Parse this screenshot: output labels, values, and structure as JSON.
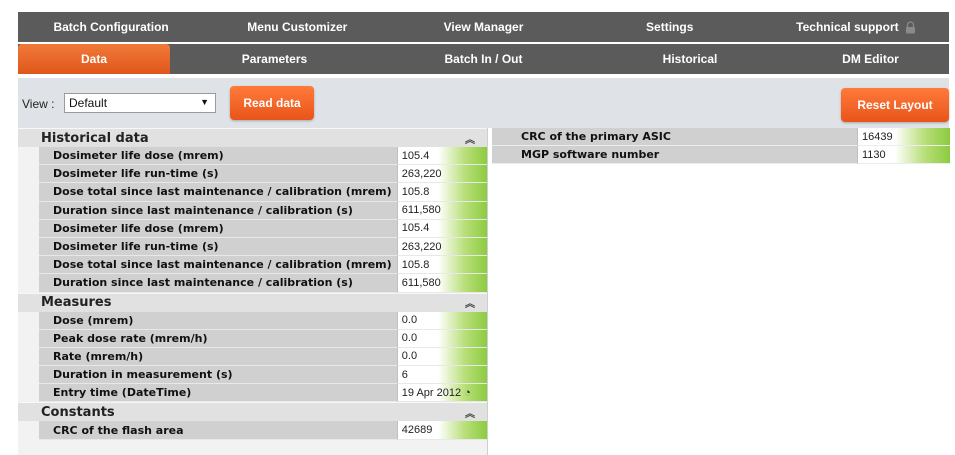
{
  "nav_top": [
    {
      "label": "Batch Configuration"
    },
    {
      "label": "Menu Customizer"
    },
    {
      "label": "View Manager"
    },
    {
      "label": "Settings"
    },
    {
      "label": "Technical support"
    }
  ],
  "nav_tabs": [
    {
      "label": "Data"
    },
    {
      "label": "Parameters"
    },
    {
      "label": "Batch In / Out"
    },
    {
      "label": "Historical"
    },
    {
      "label": "DM Editor"
    }
  ],
  "toolbar": {
    "view_label": "View :",
    "view_selected": "Default",
    "read_label": "Read data",
    "reset_label": "Reset Layout"
  },
  "sections": {
    "historical": {
      "title": "Historical data",
      "rows": [
        {
          "label": "Dosimeter life dose (mrem)",
          "value": "105.4"
        },
        {
          "label": "Dosimeter life run-time (s)",
          "value": "263,220"
        },
        {
          "label": "Dose total since last maintenance / calibration (mrem)",
          "value": "105.8"
        },
        {
          "label": "Duration since last maintenance / calibration (s)",
          "value": "611,580"
        },
        {
          "label": "Dosimeter life dose (mrem)",
          "value": "105.4"
        },
        {
          "label": "Dosimeter life run-time (s)",
          "value": "263,220"
        },
        {
          "label": "Dose total since last maintenance / calibration (mrem)",
          "value": "105.8"
        },
        {
          "label": "Duration since last maintenance / calibration (s)",
          "value": "611,580"
        }
      ]
    },
    "measures": {
      "title": "Measures",
      "rows": [
        {
          "label": "Dose  (mrem)",
          "value": "0.0"
        },
        {
          "label": "Peak dose rate  (mrem/h)",
          "value": "0.0"
        },
        {
          "label": "Rate (mrem/h)",
          "value": "0.0"
        },
        {
          "label": "Duration in measurement (s)",
          "value": "6"
        },
        {
          "label": "Entry time (DateTime)",
          "value": "19 Apr 2012 ◔"
        }
      ]
    },
    "constants": {
      "title": "Constants",
      "rows": [
        {
          "label": "CRC of the flash area",
          "value": "42689"
        }
      ]
    }
  },
  "right_rows": [
    {
      "label": "CRC of the primary ASIC",
      "value": "16439"
    },
    {
      "label": "MGP software number",
      "value": "1130"
    }
  ]
}
